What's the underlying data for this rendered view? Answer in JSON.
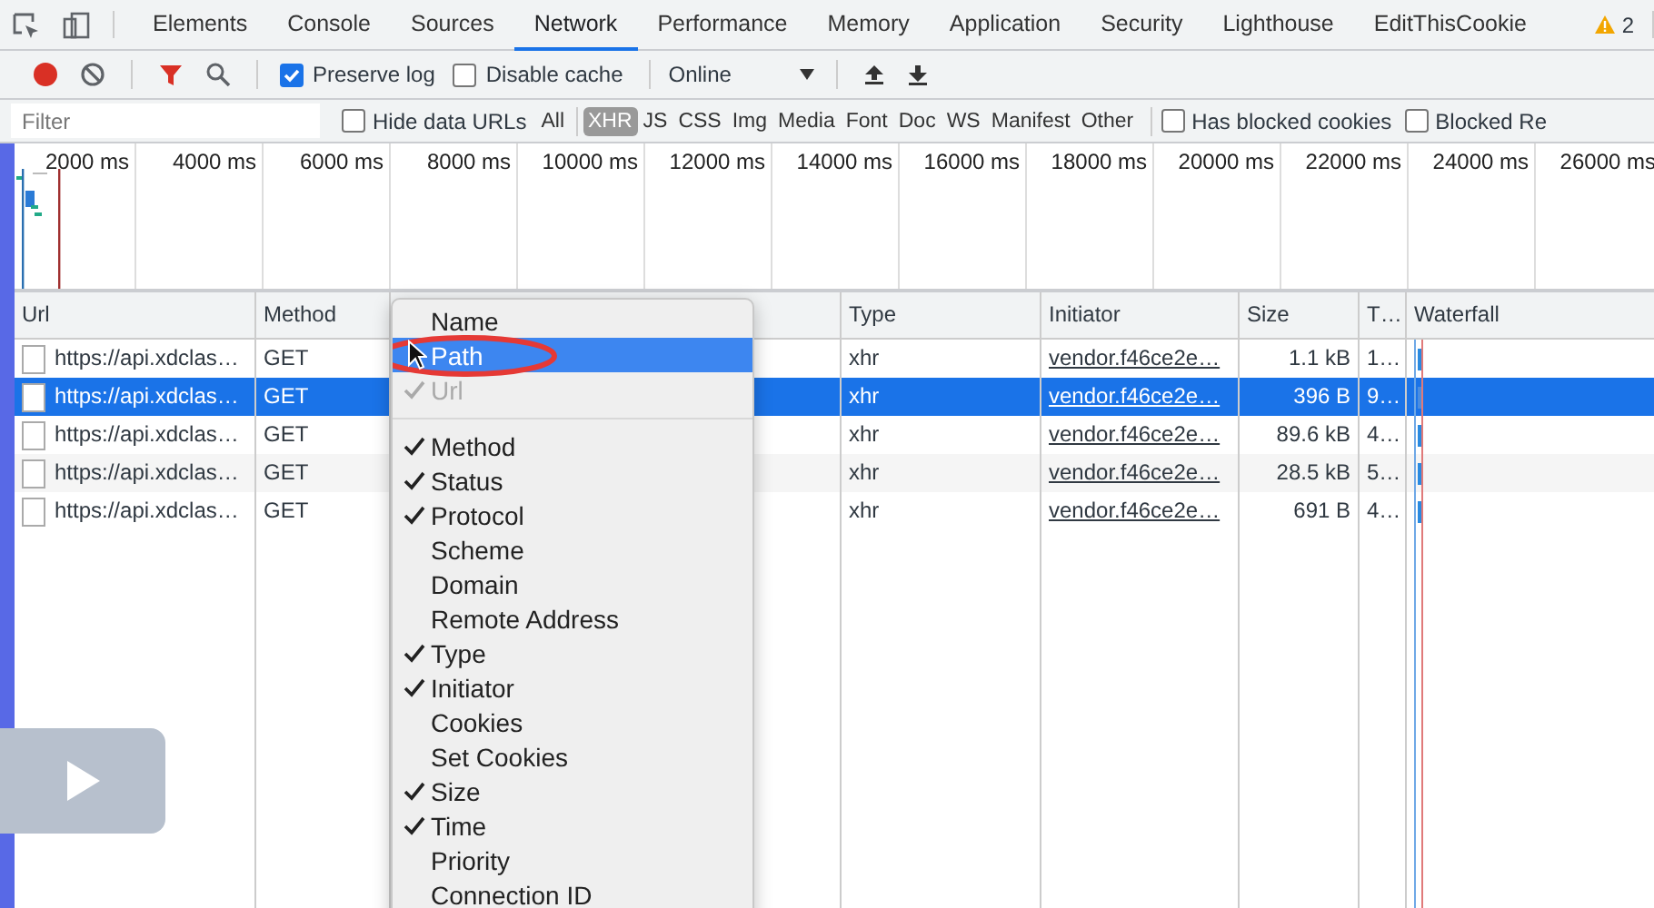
{
  "panel_tabs": [
    {
      "label": "Elements",
      "selected": false
    },
    {
      "label": "Console",
      "selected": false
    },
    {
      "label": "Sources",
      "selected": false
    },
    {
      "label": "Network",
      "selected": true
    },
    {
      "label": "Performance",
      "selected": false
    },
    {
      "label": "Memory",
      "selected": false
    },
    {
      "label": "Application",
      "selected": false
    },
    {
      "label": "Security",
      "selected": false
    },
    {
      "label": "Lighthouse",
      "selected": false
    },
    {
      "label": "EditThisCookie",
      "selected": false
    }
  ],
  "warning_count": "2",
  "network_toolbar": {
    "preserve_log": {
      "label": "Preserve log",
      "checked": true
    },
    "disable_cache": {
      "label": "Disable cache",
      "checked": false
    },
    "throttling": "Online"
  },
  "filter_bar": {
    "placeholder": "Filter",
    "hide_data_urls": {
      "label": "Hide data URLs",
      "checked": false
    },
    "types": [
      {
        "label": "All",
        "selected": false
      },
      {
        "label": "XHR",
        "selected": true
      },
      {
        "label": "JS",
        "selected": false
      },
      {
        "label": "CSS",
        "selected": false
      },
      {
        "label": "Img",
        "selected": false
      },
      {
        "label": "Media",
        "selected": false
      },
      {
        "label": "Font",
        "selected": false
      },
      {
        "label": "Doc",
        "selected": false
      },
      {
        "label": "WS",
        "selected": false
      },
      {
        "label": "Manifest",
        "selected": false
      },
      {
        "label": "Other",
        "selected": false
      }
    ],
    "has_blocked_cookies": {
      "label": "Has blocked cookies",
      "checked": false
    },
    "blocked_requests": {
      "label": "Blocked Re",
      "checked": false
    }
  },
  "overview": {
    "ticks": [
      "2000 ms",
      "4000 ms",
      "6000 ms",
      "8000 ms",
      "10000 ms",
      "12000 ms",
      "14000 ms",
      "16000 ms",
      "18000 ms",
      "20000 ms",
      "22000 ms",
      "24000 ms",
      "26000 ms"
    ]
  },
  "table": {
    "columns": [
      "Url",
      "Method",
      "Type",
      "Initiator",
      "Size",
      "T…",
      "Waterfall"
    ],
    "rows": [
      {
        "url": "https://api.xdclas…",
        "method": "GET",
        "type": "xhr",
        "initiator": "vendor.f46ce2e…",
        "size": "1.1 kB",
        "time": "1…",
        "selected": false
      },
      {
        "url": "https://api.xdclas…",
        "method": "GET",
        "type": "xhr",
        "initiator": "vendor.f46ce2e…",
        "size": "396 B",
        "time": "9…",
        "selected": true
      },
      {
        "url": "https://api.xdclas…",
        "method": "GET",
        "type": "xhr",
        "initiator": "vendor.f46ce2e…",
        "size": "89.6 kB",
        "time": "4…",
        "selected": false
      },
      {
        "url": "https://api.xdclas…",
        "method": "GET",
        "type": "xhr",
        "initiator": "vendor.f46ce2e…",
        "size": "28.5 kB",
        "time": "5…",
        "selected": false
      },
      {
        "url": "https://api.xdclas…",
        "method": "GET",
        "type": "xhr",
        "initiator": "vendor.f46ce2e…",
        "size": "691 B",
        "time": "4…",
        "selected": false
      }
    ]
  },
  "context_menu": {
    "items": [
      {
        "kind": "item",
        "label": "Name",
        "checked": false,
        "disabled": false,
        "selected": false
      },
      {
        "kind": "item",
        "label": "Path",
        "checked": false,
        "disabled": false,
        "selected": true
      },
      {
        "kind": "item",
        "label": "Url",
        "checked": true,
        "disabled": true,
        "selected": false
      },
      {
        "kind": "separator"
      },
      {
        "kind": "item",
        "label": "Method",
        "checked": true,
        "disabled": false,
        "selected": false
      },
      {
        "kind": "item",
        "label": "Status",
        "checked": true,
        "disabled": false,
        "selected": false
      },
      {
        "kind": "item",
        "label": "Protocol",
        "checked": true,
        "disabled": false,
        "selected": false
      },
      {
        "kind": "item",
        "label": "Scheme",
        "checked": false,
        "disabled": false,
        "selected": false
      },
      {
        "kind": "item",
        "label": "Domain",
        "checked": false,
        "disabled": false,
        "selected": false
      },
      {
        "kind": "item",
        "label": "Remote Address",
        "checked": false,
        "disabled": false,
        "selected": false
      },
      {
        "kind": "item",
        "label": "Type",
        "checked": true,
        "disabled": false,
        "selected": false
      },
      {
        "kind": "item",
        "label": "Initiator",
        "checked": true,
        "disabled": false,
        "selected": false
      },
      {
        "kind": "item",
        "label": "Cookies",
        "checked": false,
        "disabled": false,
        "selected": false
      },
      {
        "kind": "item",
        "label": "Set Cookies",
        "checked": false,
        "disabled": false,
        "selected": false
      },
      {
        "kind": "item",
        "label": "Size",
        "checked": true,
        "disabled": false,
        "selected": false
      },
      {
        "kind": "item",
        "label": "Time",
        "checked": true,
        "disabled": false,
        "selected": false
      },
      {
        "kind": "item",
        "label": "Priority",
        "checked": false,
        "disabled": false,
        "selected": false
      },
      {
        "kind": "item",
        "label": "Connection ID",
        "checked": false,
        "disabled": false,
        "selected": false
      }
    ]
  }
}
